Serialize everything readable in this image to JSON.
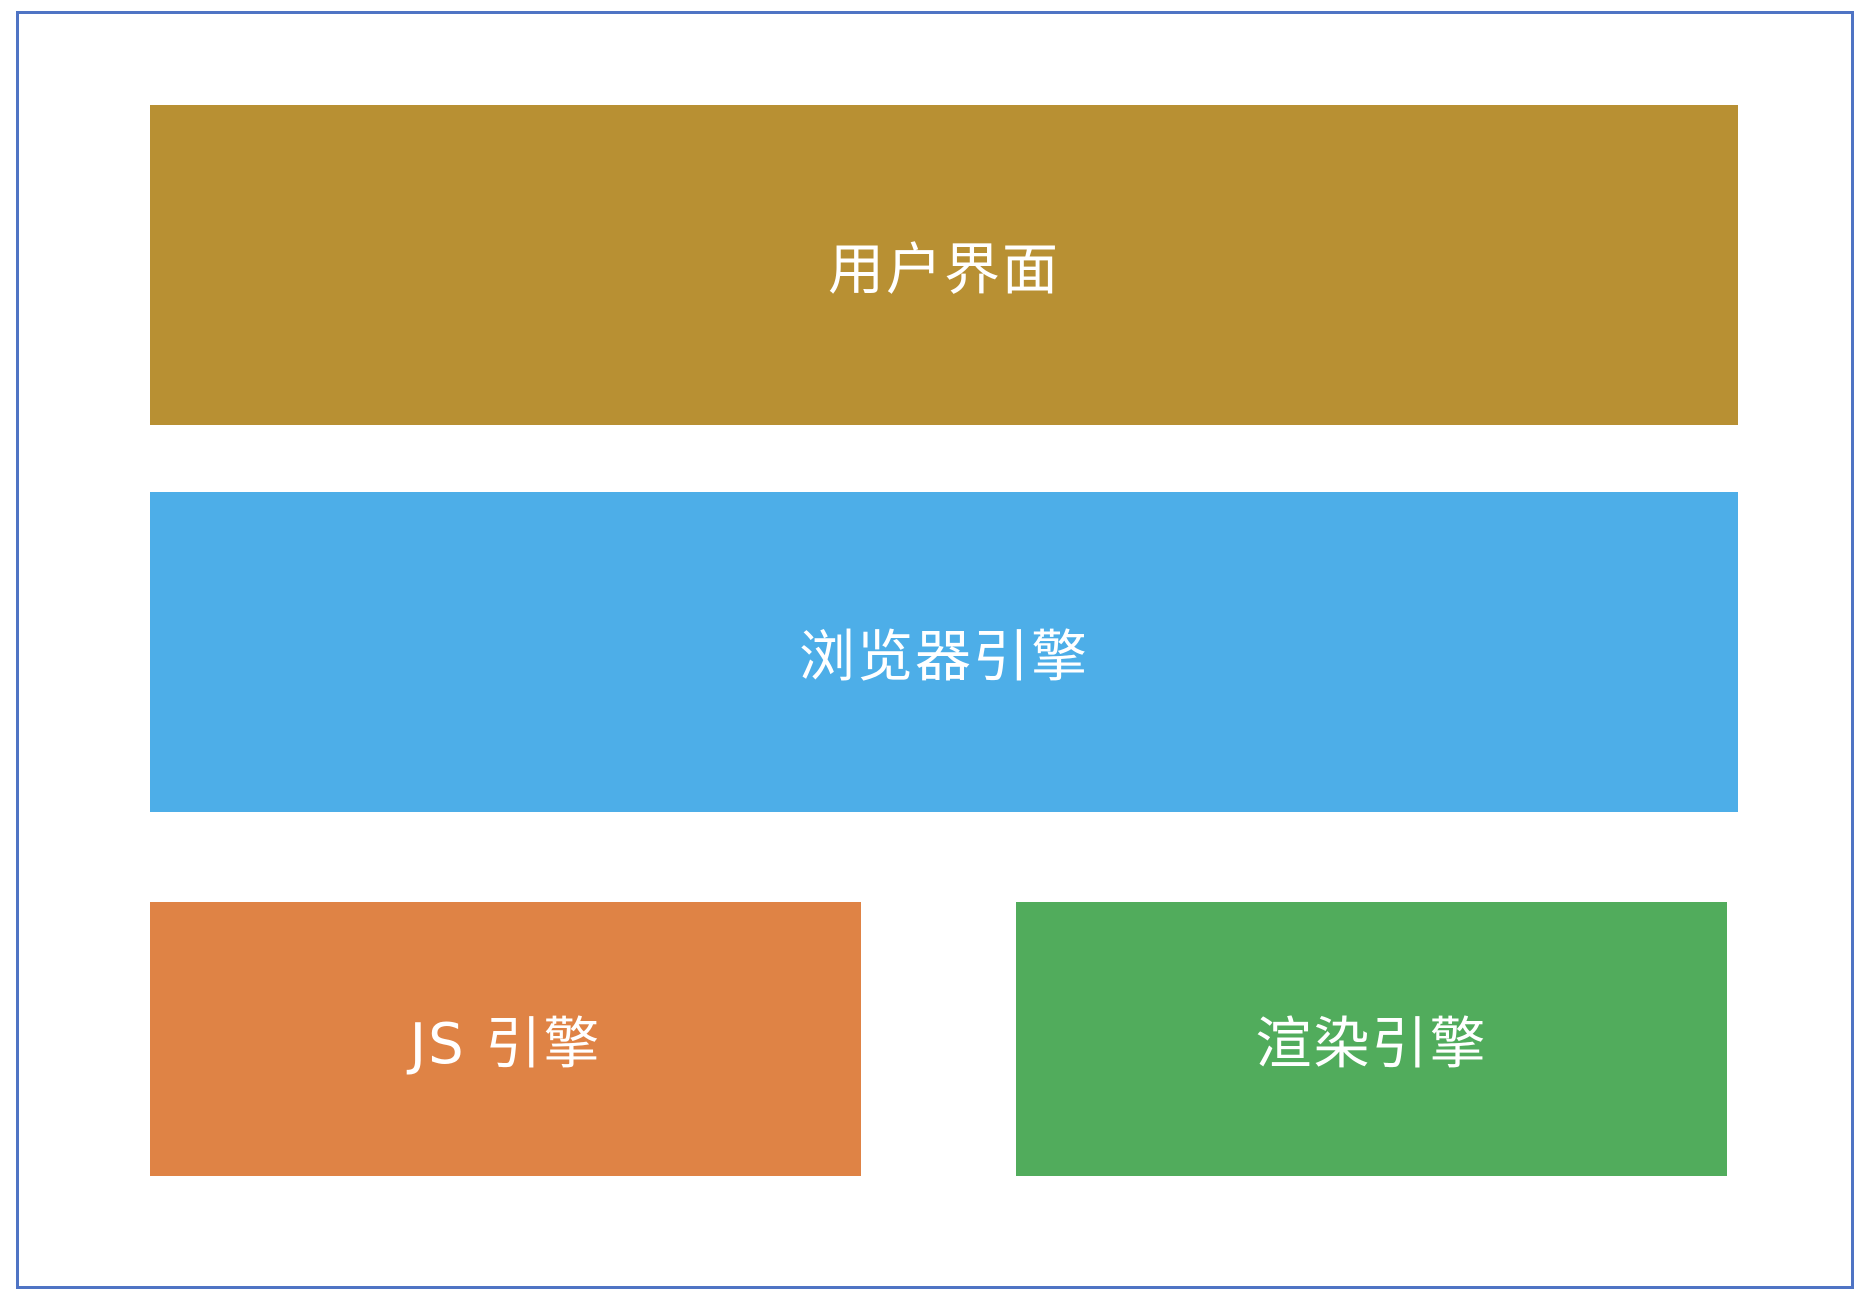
{
  "blocks": {
    "user_interface": {
      "label": "用户界面",
      "color": "#b89033"
    },
    "browser_engine": {
      "label": "浏览器引擎",
      "color": "#4daee8"
    },
    "js_engine": {
      "label": "JS 引擎",
      "color": "#df8345"
    },
    "rendering_engine": {
      "label": "渲染引擎",
      "color": "#51ac5c"
    }
  },
  "frame_color": "#4f74c4"
}
